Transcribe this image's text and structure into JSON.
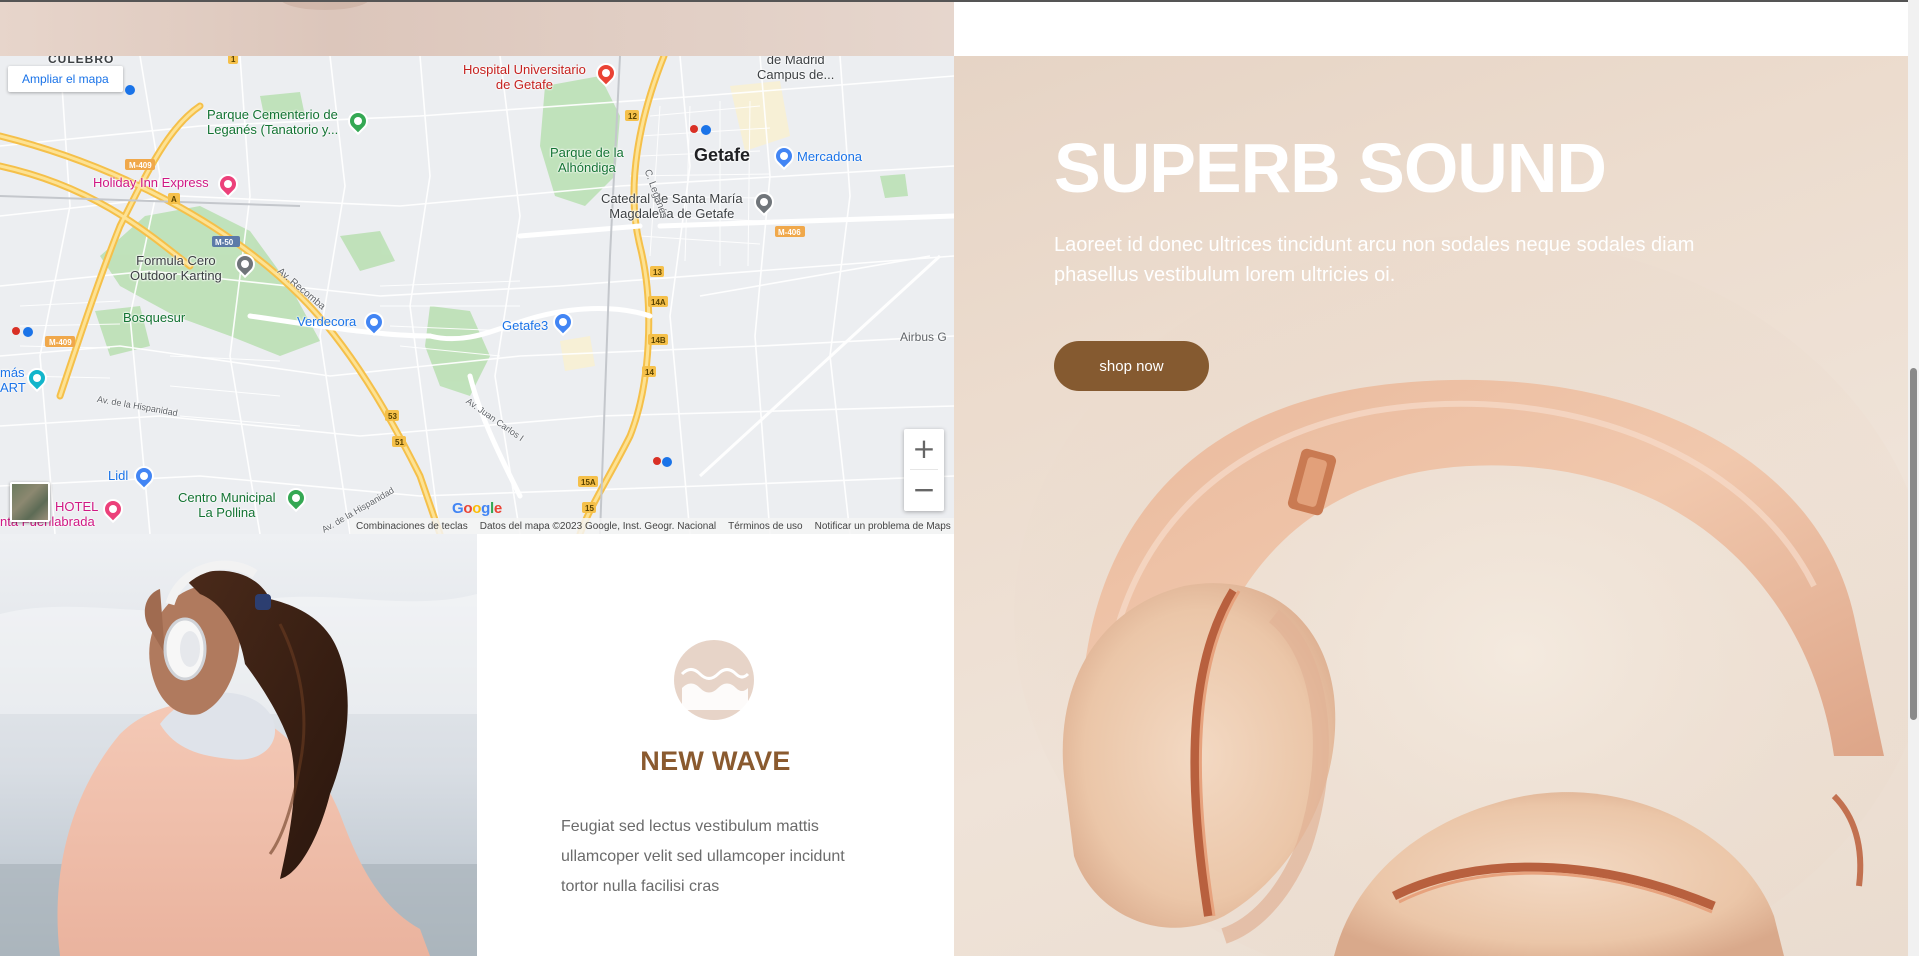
{
  "map": {
    "enlarge_link": "Ampliar el mapa",
    "places": {
      "culebro": "CULEBRO",
      "hospital": "Hospital Universitario\nde Getafe",
      "madrid_campus": "de Madrid\nCampus de...",
      "parque_cementerio": "Parque Cementerio de\nLeganés (Tanatorio y...",
      "holiday_inn": "Holiday Inn Express",
      "parque_alhondiga": "Parque de la\nAlhóndiga",
      "getafe": "Getafe",
      "mercadona": "Mercadona",
      "catedral": "Catedral de Santa María\nMagdalena de Getafe",
      "formula_cero": "Formula Cero\nOutdoor Karting",
      "bosquesur": "Bosquesur",
      "verdecora": "Verdecora",
      "getafe3": "Getafe3",
      "airbus": "Airbus G",
      "mas_art": "más\nART",
      "lidl": "Lidl",
      "centro_municipal": "Centro Municipal\nLa Pollina",
      "hotel": "HOTEL",
      "fuenlabrada": "nta Fuenlabrada",
      "c_leganes": "C. Leganés",
      "av_recomba": "Av. Recomba",
      "av_hispanidad": "Av. de la Hispanidad",
      "av_hispanidad_2": "Av. de la Hispanidad",
      "av_juan_carlos": "Av. Juan Carlos I"
    },
    "road_labels": [
      "M-409",
      "A",
      "M-50",
      "M-409",
      "12",
      "13",
      "14A",
      "14B",
      "14",
      "M-406",
      "53",
      "51",
      "15A",
      "15",
      "1"
    ],
    "zoom_in": "+",
    "zoom_out": "−",
    "google_logo_letters": [
      "G",
      "o",
      "o",
      "g",
      "l",
      "e"
    ],
    "attribution": {
      "shortcuts": "Combinaciones de teclas",
      "data": "Datos del mapa ©2023 Google, Inst. Geogr. Nacional",
      "terms": "Términos de uso",
      "report": "Notificar un problema de Maps"
    }
  },
  "wave_card": {
    "title": "NEW WAVE",
    "text": "Feugiat sed lectus vestibulum mattis ullamcoper velit sed ullamcoper incidunt tortor nulla facilisi cras"
  },
  "hero": {
    "title": "SUPERB SOUND",
    "text": "Laoreet id donec ultrices tincidunt arcu non sodales neque sodales diam phasellus vestibulum lorem ultricies oi.",
    "button": "shop now"
  },
  "colors": {
    "accent_brown": "#855a30",
    "title_brown": "#8a5a2f",
    "hero_bg": "#ecdcce",
    "wave_icon_bg": "#e7d4c8"
  },
  "icons": [
    "map-pin-icon",
    "hospital-icon",
    "cart-icon",
    "church-icon",
    "bed-icon",
    "park-icon",
    "train-icon",
    "plus-icon",
    "minus-icon",
    "wave-icon"
  ]
}
